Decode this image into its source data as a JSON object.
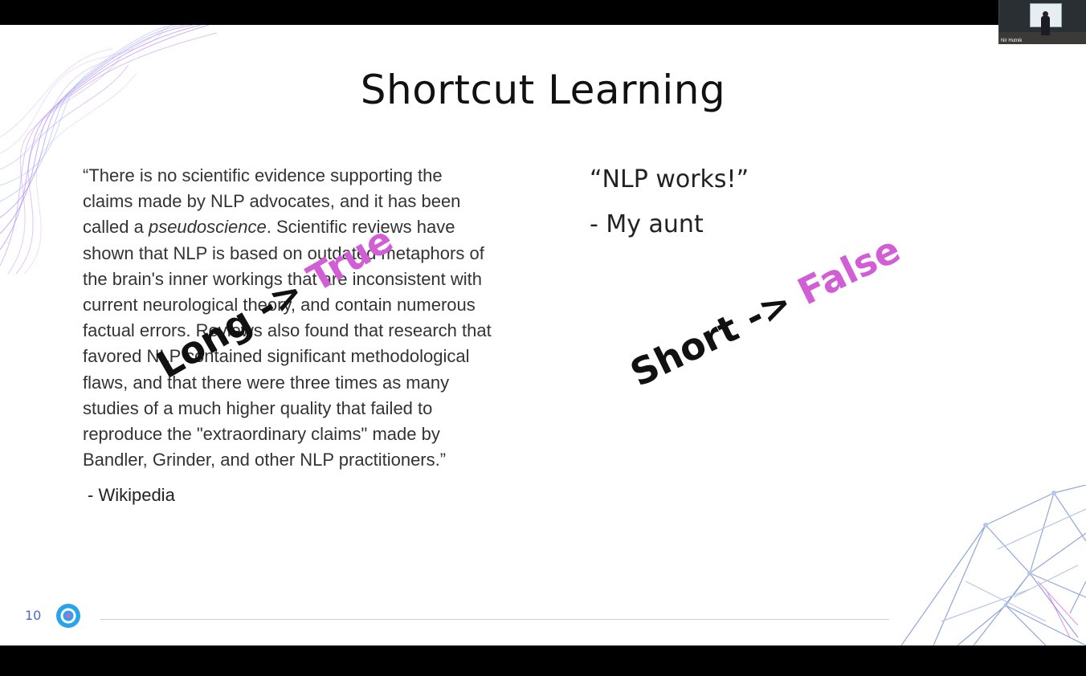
{
  "slide": {
    "title": "Shortcut Learning",
    "quote_lines": [
      [
        "“There is no scientific evidence supporting the"
      ],
      [
        "claims made by NLP advocates, and it has been"
      ],
      [
        "called a ",
        "pseudoscience",
        ". Scientific reviews have"
      ],
      [
        "shown that NLP is based on outdated metaphors of"
      ],
      [
        "the brain's inner workings that are inconsistent with"
      ],
      [
        "current neurological theory, and contain numerous"
      ],
      [
        "factual errors. Reviews also found that research that"
      ],
      [
        "favored NLP contained significant methodological"
      ],
      [
        "flaws, and that there were three times as many"
      ],
      [
        "studies of a much higher quality that failed to"
      ],
      [
        "reproduce the \"extraordinary claims\" made by"
      ],
      [
        "Bandler, Grinder, and other NLP practitioners.”"
      ]
    ],
    "quote_attribution": "- Wikipedia",
    "right_quote": "“NLP works!”",
    "right_attribution": "- My aunt",
    "overlay_long": {
      "prefix": "Long -> ",
      "value": "True"
    },
    "overlay_short": {
      "prefix": "Short -> ",
      "value": "False"
    },
    "page_number": "10",
    "accent_pink": "#d25ed6",
    "accent_blue": "#4a6bc8"
  },
  "video_call": {
    "participant_name": "Nir Hutnik"
  }
}
